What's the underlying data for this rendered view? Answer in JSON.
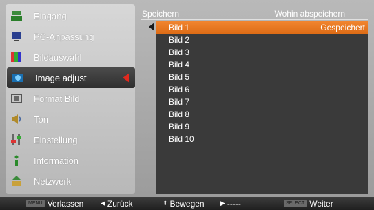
{
  "menu": {
    "items": [
      {
        "label": "Eingang",
        "icon": "input-icon"
      },
      {
        "label": "PC-Anpassung",
        "icon": "pc-adjust-icon"
      },
      {
        "label": "Bildauswahl",
        "icon": "image-select-icon"
      },
      {
        "label": "Image adjust",
        "icon": "image-adjust-icon"
      },
      {
        "label": "Format Bild",
        "icon": "screen-format-icon"
      },
      {
        "label": "Ton",
        "icon": "sound-icon"
      },
      {
        "label": "Einstellung",
        "icon": "settings-icon"
      },
      {
        "label": "Information",
        "icon": "information-icon"
      },
      {
        "label": "Netzwerk",
        "icon": "network-icon"
      }
    ],
    "selected_index": 3
  },
  "panel": {
    "header_left": "Speichern",
    "header_right": "Wohin abspeichern",
    "rows": [
      {
        "label": "Bild 1",
        "status": "Gespeichert"
      },
      {
        "label": "Bild 2",
        "status": ""
      },
      {
        "label": "Bild 3",
        "status": ""
      },
      {
        "label": "Bild 4",
        "status": ""
      },
      {
        "label": "Bild 5",
        "status": ""
      },
      {
        "label": "Bild 6",
        "status": ""
      },
      {
        "label": "Bild 7",
        "status": ""
      },
      {
        "label": "Bild 8",
        "status": ""
      },
      {
        "label": "Bild 9",
        "status": ""
      },
      {
        "label": "Bild 10",
        "status": ""
      }
    ],
    "selected_row": 0
  },
  "footer": {
    "exit_key": "MENU",
    "exit": "Verlassen",
    "back": "Zurück",
    "move": "Bewegen",
    "next": "-----",
    "select_key": "SELECT",
    "select": "Weiter"
  },
  "colors": {
    "selection_orange": "#e8781f",
    "arrow_red": "#e1291e",
    "menu_selected": "#3b3b3b"
  }
}
